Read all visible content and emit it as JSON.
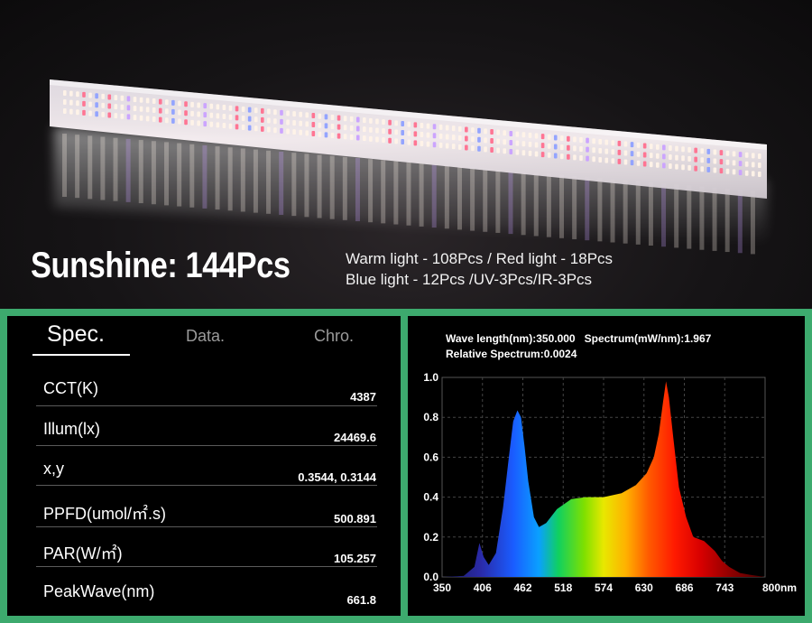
{
  "hero": {
    "title": "Sunshine: 144Pcs",
    "line1": "Warm light - 108Pcs / Red light - 18Pcs",
    "line2": "Blue light - 12Pcs /UV-3Pcs/IR-3Pcs"
  },
  "tabs": {
    "spec": "Spec.",
    "data": "Data.",
    "chro": "Chro."
  },
  "specs": [
    {
      "label": "CCT(K)",
      "value": "4387"
    },
    {
      "label": "Illum(lx)",
      "value": "24469.6"
    },
    {
      "label": "x,y",
      "value": "0.3544, 0.3144"
    },
    {
      "label": "PPFD(umol/㎡.s)",
      "value": "500.891"
    },
    {
      "label": "PAR(W/㎡)",
      "value": "105.257"
    },
    {
      "label": "PeakWave(nm)",
      "value": "661.8"
    }
  ],
  "chart_info": {
    "wavelength": "Wave length(nm):350.000",
    "spectrum": "Spectrum(mW/nm):1.967",
    "relative": "Relative Spectrum:0.0024"
  },
  "chart_data": {
    "type": "area",
    "title": "",
    "xlabel": "",
    "ylabel": "",
    "xlim": [
      350,
      800
    ],
    "ylim": [
      0,
      1.0
    ],
    "x_ticks": [
      "350",
      "406",
      "462",
      "518",
      "574",
      "630",
      "686",
      "743",
      "800nm"
    ],
    "y_ticks": [
      "0.0",
      "0.2",
      "0.4",
      "0.6",
      "0.8",
      "1.0"
    ],
    "grid": true,
    "x": [
      350,
      380,
      395,
      402,
      408,
      415,
      425,
      435,
      443,
      449,
      455,
      460,
      465,
      470,
      478,
      485,
      495,
      510,
      530,
      550,
      575,
      600,
      620,
      635,
      645,
      652,
      658,
      662,
      666,
      672,
      680,
      690,
      700,
      715,
      730,
      740,
      750,
      765,
      780,
      800
    ],
    "values": [
      0.0,
      0.005,
      0.05,
      0.17,
      0.1,
      0.06,
      0.12,
      0.35,
      0.6,
      0.78,
      0.835,
      0.8,
      0.65,
      0.48,
      0.3,
      0.25,
      0.27,
      0.34,
      0.39,
      0.4,
      0.4,
      0.42,
      0.46,
      0.52,
      0.6,
      0.72,
      0.88,
      0.98,
      0.9,
      0.7,
      0.45,
      0.3,
      0.2,
      0.18,
      0.13,
      0.08,
      0.05,
      0.02,
      0.01,
      0.0
    ]
  },
  "colors": {
    "frame": "#3daa6e",
    "panel": "#000000"
  }
}
